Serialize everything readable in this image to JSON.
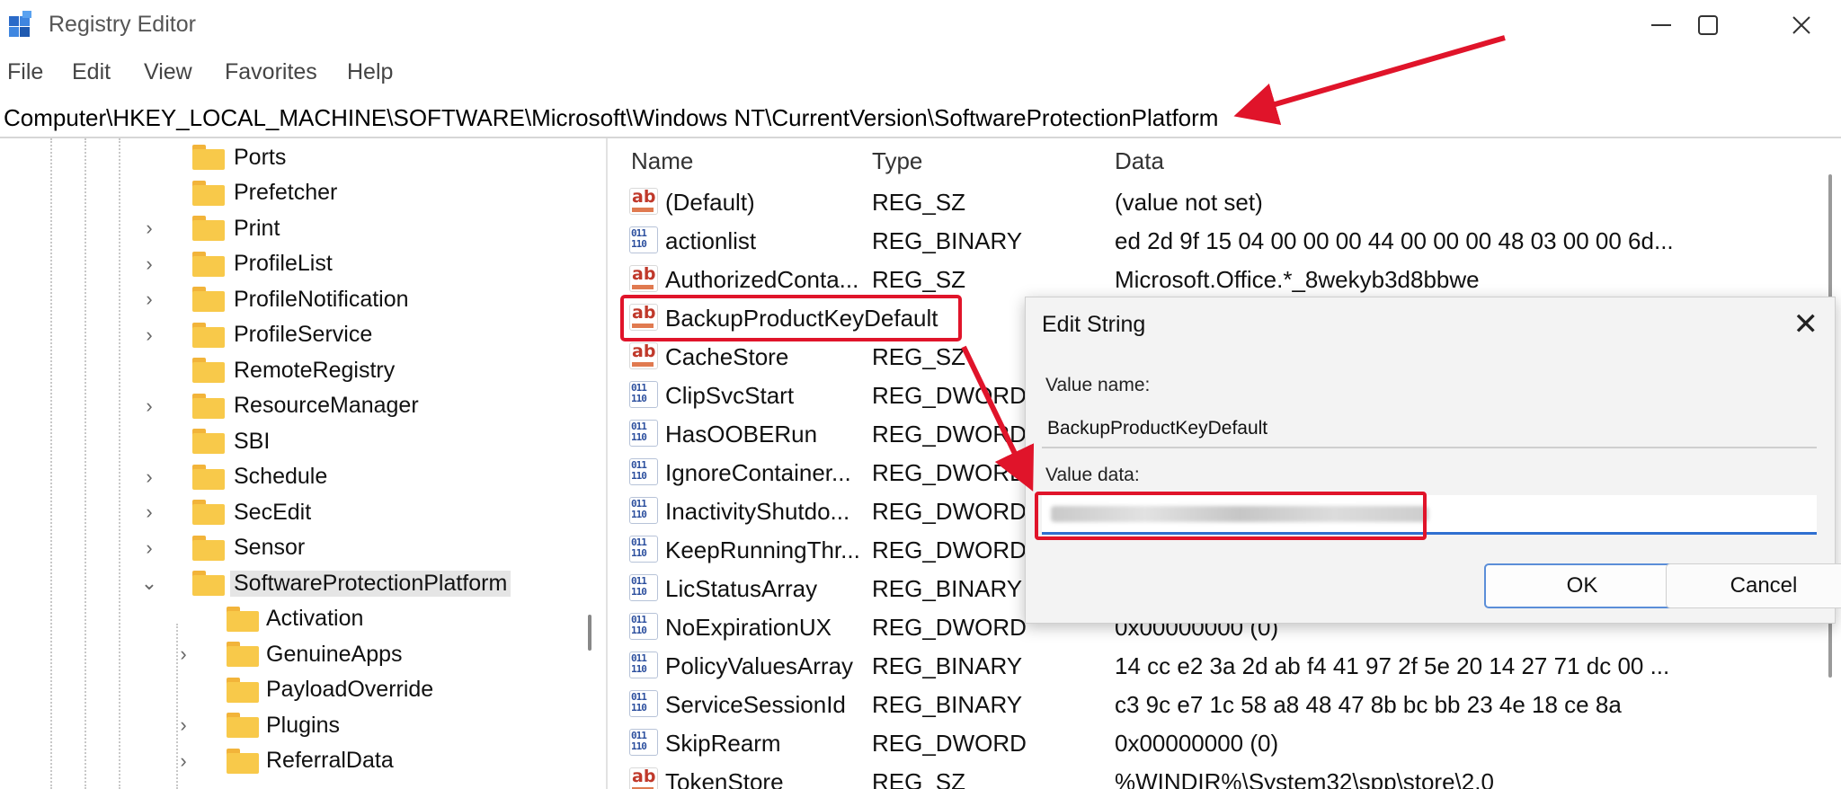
{
  "window": {
    "title": "Registry Editor",
    "controls": [
      "minimize-icon",
      "maximize-icon",
      "close-icon"
    ]
  },
  "menu": {
    "items": [
      "File",
      "Edit",
      "View",
      "Favorites",
      "Help"
    ]
  },
  "address": {
    "path": "Computer\\HKEY_LOCAL_MACHINE\\SOFTWARE\\Microsoft\\Windows NT\\CurrentVersion\\SoftwareProtectionPlatform"
  },
  "tree": {
    "items": [
      {
        "label": "Ports",
        "expander": ""
      },
      {
        "label": "Prefetcher",
        "expander": ""
      },
      {
        "label": "Print",
        "expander": "›"
      },
      {
        "label": "ProfileList",
        "expander": "›"
      },
      {
        "label": "ProfileNotification",
        "expander": "›"
      },
      {
        "label": "ProfileService",
        "expander": "›"
      },
      {
        "label": "RemoteRegistry",
        "expander": ""
      },
      {
        "label": "ResourceManager",
        "expander": "›"
      },
      {
        "label": "SBI",
        "expander": ""
      },
      {
        "label": "Schedule",
        "expander": "›"
      },
      {
        "label": "SecEdit",
        "expander": "›"
      },
      {
        "label": "Sensor",
        "expander": "›"
      },
      {
        "label": "SoftwareProtectionPlatform",
        "expander": "⌄",
        "selected": true
      },
      {
        "label": "Activation",
        "expander": "",
        "child": true
      },
      {
        "label": "GenuineApps",
        "expander": "›",
        "child": true
      },
      {
        "label": "PayloadOverride",
        "expander": "",
        "child": true
      },
      {
        "label": "Plugins",
        "expander": "›",
        "child": true
      },
      {
        "label": "ReferralData",
        "expander": "›",
        "child": true
      }
    ]
  },
  "list": {
    "headers": {
      "name": "Name",
      "type": "Type",
      "data": "Data"
    },
    "rows": [
      {
        "name": "(Default)",
        "type": "REG_SZ",
        "data": "(value not set)",
        "icon": "string-value-icon"
      },
      {
        "name": "actionlist",
        "type": "REG_BINARY",
        "data": "ed 2d 9f 15 04 00 00 00 44 00 00 00 48 03 00 00 6d...",
        "icon": "binary-value-icon"
      },
      {
        "name": "AuthorizedConta...",
        "type": "REG_SZ",
        "data": "Microsoft.Office.*_8wekyb3d8bbwe",
        "icon": "string-value-icon"
      },
      {
        "name": "BackupProductKeyDefault",
        "type": "",
        "data": "",
        "icon": "string-value-icon"
      },
      {
        "name": "CacheStore",
        "type": "REG_SZ",
        "data": "",
        "icon": "string-value-icon"
      },
      {
        "name": "ClipSvcStart",
        "type": "REG_DWORD",
        "data": "",
        "icon": "binary-value-icon"
      },
      {
        "name": "HasOOBERun",
        "type": "REG_DWORD",
        "data": "",
        "icon": "binary-value-icon"
      },
      {
        "name": "IgnoreContainer...",
        "type": "REG_DWORD",
        "data": "",
        "icon": "binary-value-icon"
      },
      {
        "name": "InactivityShutdo...",
        "type": "REG_DWORD",
        "data": "",
        "icon": "binary-value-icon"
      },
      {
        "name": "KeepRunningThr...",
        "type": "REG_DWORD",
        "data": "",
        "icon": "binary-value-icon"
      },
      {
        "name": "LicStatusArray",
        "type": "REG_BINARY",
        "data": "",
        "icon": "binary-value-icon"
      },
      {
        "name": "NoExpirationUX",
        "type": "REG_DWORD",
        "data": "0x00000000 (0)",
        "icon": "binary-value-icon"
      },
      {
        "name": "PolicyValuesArray",
        "type": "REG_BINARY",
        "data": "14 cc e2 3a 2d ab f4 41 97 2f 5e 20 14 27 71 dc 00 ...",
        "icon": "binary-value-icon"
      },
      {
        "name": "ServiceSessionId",
        "type": "REG_BINARY",
        "data": "c3 9c e7 1c 58 a8 48 47 8b bc bb 23 4e 18 ce 8a",
        "icon": "binary-value-icon"
      },
      {
        "name": "SkipRearm",
        "type": "REG_DWORD",
        "data": "0x00000000 (0)",
        "icon": "binary-value-icon"
      },
      {
        "name": "TokenStore",
        "type": "REG_SZ",
        "data": "%WINDIR%\\System32\\spp\\store\\2.0",
        "icon": "string-value-icon"
      }
    ]
  },
  "dialog": {
    "title": "Edit String",
    "value_name_label": "Value name:",
    "value_name": "BackupProductKeyDefault",
    "value_data_label": "Value data:",
    "value_data_obscured": true,
    "ok_label": "OK",
    "cancel_label": "Cancel"
  },
  "annotations": {
    "color": "#e0142a"
  }
}
